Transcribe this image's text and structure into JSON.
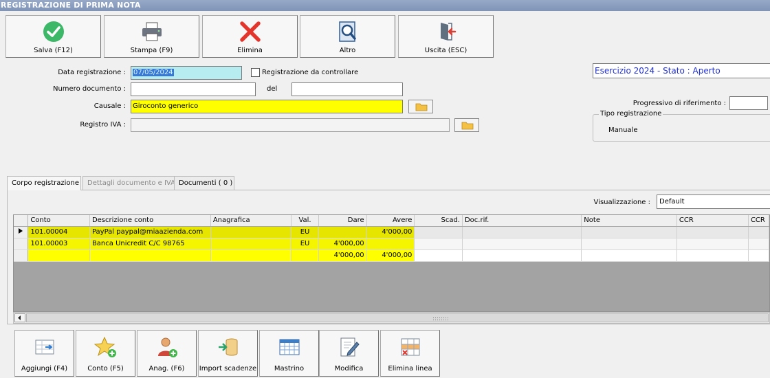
{
  "window": {
    "title": "REGISTRAZIONE DI PRIMA NOTA"
  },
  "toolbar": [
    {
      "label": "Salva (F12)",
      "icon": "check-icon"
    },
    {
      "label": "Stampa (F9)",
      "icon": "printer-icon"
    },
    {
      "label": "Elimina",
      "icon": "delete-x-icon"
    },
    {
      "label": "Altro",
      "icon": "search-doc-icon"
    },
    {
      "label": "Uscita (ESC)",
      "icon": "exit-door-icon"
    }
  ],
  "form": {
    "data_registrazione_label": "Data registrazione :",
    "data_registrazione_value": "07/05/2024",
    "da_controllare_label": "Registrazione da controllare",
    "numero_documento_label": "Numero documento :",
    "numero_documento_value": "",
    "del_label": "del",
    "del_value": "",
    "causale_label": "Causale :",
    "causale_value": "Giroconto generico",
    "registro_iva_label": "Registro IVA :",
    "registro_iva_value": ""
  },
  "info": {
    "esercizio": "Esercizio 2024 - Stato : Aperto",
    "progressivo_label": "Progressivo di riferimento :",
    "progressivo_value": "",
    "tipo_registrazione_label": "Tipo registrazione",
    "tipo_registrazione_value": "Manuale"
  },
  "tabs": [
    {
      "label": "Corpo registrazione",
      "state": "active"
    },
    {
      "label": "Dettagli documento e IVA",
      "state": "disabled"
    },
    {
      "label": "Documenti ( 0 )",
      "state": "normal"
    }
  ],
  "visualizzazione": {
    "label": "Visualizzazione :",
    "value": "Default"
  },
  "grid": {
    "columns": [
      "Conto",
      "Descrizione conto",
      "Anagrafica",
      "Val.",
      "Dare",
      "Avere",
      "Scad.",
      "Doc.rif.",
      "Note",
      "CCR",
      "CCR"
    ],
    "rows": [
      [
        "101.00004",
        "PayPal paypal@miaazienda.com",
        "",
        "EU",
        "",
        "4'000,00",
        "",
        "",
        "",
        "",
        ""
      ],
      [
        "101.00003",
        "Banca Unicredit C/C 98765",
        "",
        "EU",
        "4'000,00",
        "",
        "",
        "",
        "",
        "",
        ""
      ],
      [
        "",
        "",
        "",
        "",
        "4'000,00",
        "4'000,00",
        "",
        "",
        "",
        "",
        ""
      ]
    ]
  },
  "bottom_toolbar": [
    {
      "label": "Aggiungi (F4)",
      "icon": "add-row-icon"
    },
    {
      "label": "Conto (F5)",
      "icon": "star-add-icon"
    },
    {
      "label": "Anag. (F6)",
      "icon": "user-add-icon"
    },
    {
      "label": "Import scadenze",
      "icon": "import-db-icon"
    },
    {
      "label": "Mastrino",
      "icon": "ledger-icon"
    },
    {
      "label": "Modifica",
      "icon": "edit-doc-icon"
    },
    {
      "label": "Elimina linea",
      "icon": "delete-row-icon"
    }
  ]
}
